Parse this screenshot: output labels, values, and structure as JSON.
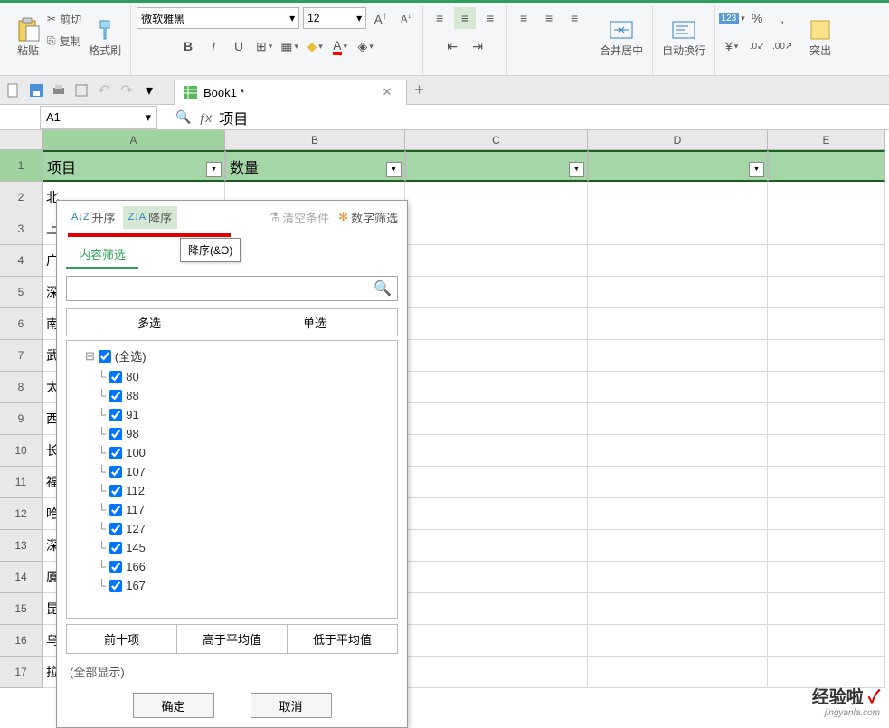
{
  "ribbon": {
    "paste": "粘贴",
    "cut": "剪切",
    "copy": "复制",
    "format_painter": "格式刷",
    "font_name": "微软雅黑",
    "font_size": "12",
    "bold": "B",
    "italic": "I",
    "underline": "U",
    "merge_center": "合并居中",
    "wrap_text": "自动换行",
    "percent": "%",
    "highlight": "突出"
  },
  "tabs": {
    "book": "Book1 *"
  },
  "formula": {
    "name_box": "A1",
    "fx": "ƒx",
    "value": "项目"
  },
  "columns": [
    "A",
    "B",
    "C",
    "D",
    "E"
  ],
  "header_row": {
    "a": "项目",
    "b": "数量"
  },
  "row_data_a": [
    "北",
    "上",
    "广",
    "深",
    "南",
    "武",
    "太",
    "西",
    "长",
    "福",
    "哈",
    "深",
    "厦",
    "昆",
    "乌",
    "拉"
  ],
  "filter_panel": {
    "sort_asc": "升序",
    "sort_desc": "降序",
    "tooltip": "降序(&O)",
    "clear": "清空条件",
    "num_filter": "数字筛选",
    "tab_content": "内容筛选",
    "search_placeholder": "",
    "multi": "多选",
    "single": "单选",
    "all": "(全选)",
    "items": [
      "80",
      "88",
      "91",
      "98",
      "100",
      "107",
      "112",
      "117",
      "127",
      "145",
      "166",
      "167"
    ],
    "top10": "前十项",
    "above_avg": "高于平均值",
    "below_avg": "低于平均值",
    "all_show": "(全部显示)",
    "ok": "确定",
    "cancel": "取消"
  },
  "watermark": {
    "text": "经验啦",
    "check": "✓",
    "url": "jingyanla.com"
  }
}
